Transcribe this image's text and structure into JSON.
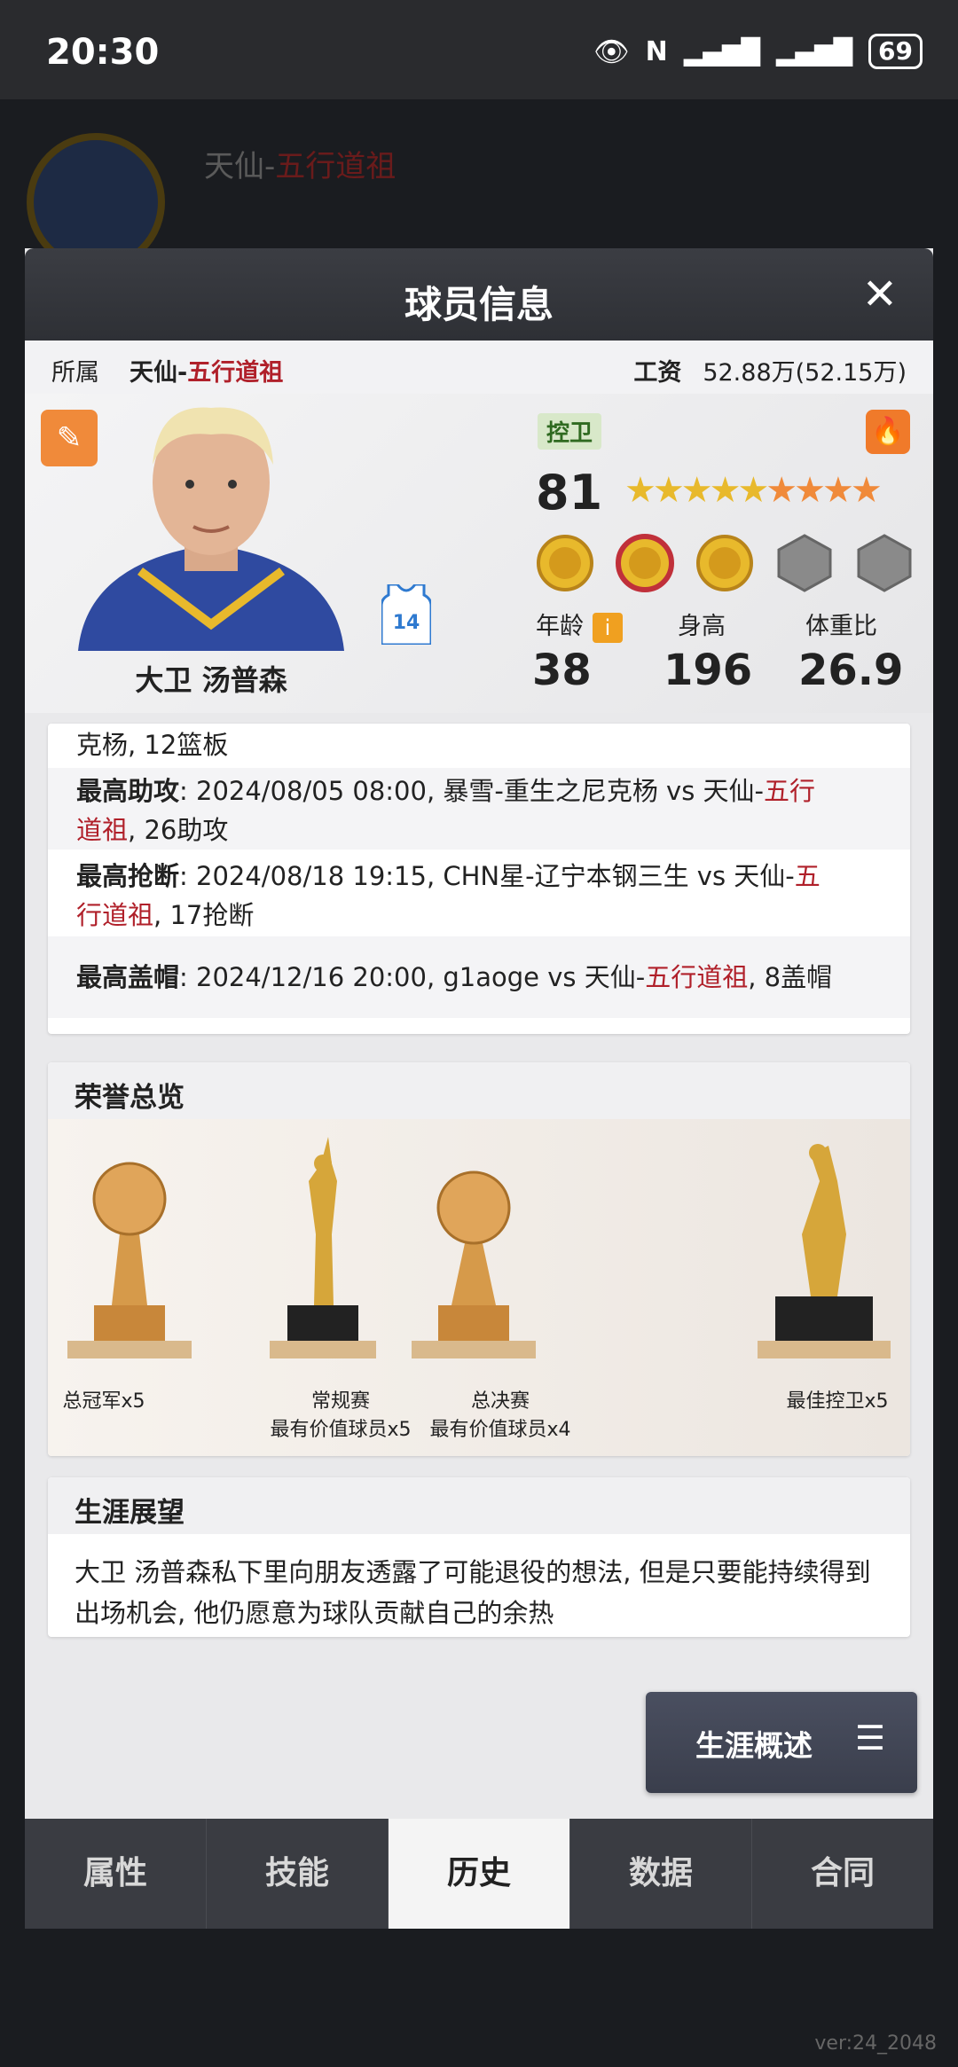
{
  "status": {
    "time": "20:30",
    "battery": "69"
  },
  "background": {
    "team_prefix": "天仙-",
    "team_suffix": "五行道祖",
    "version": "ver:24_2048"
  },
  "modal": {
    "title": "球员信息",
    "team_label": "所属",
    "team_prefix": "天仙-",
    "team_suffix": "五行道祖",
    "salary_label": "工资",
    "salary_value": "52.88万(52.15万)"
  },
  "player": {
    "position": "控卫",
    "rating": "81",
    "stars_gold": 5,
    "stars_orange": 4,
    "jersey_number": "14",
    "name": "大卫 汤普森",
    "age_label": "年龄",
    "age": "38",
    "height_label": "身高",
    "height": "196",
    "bmi_label": "体重比",
    "bmi": "26.9"
  },
  "records": {
    "line0": "克杨, 12篮板",
    "line1_label": "最高助攻",
    "line1_text": ": 2024/08/05 08:00, 暴雪-重生之尼克杨 vs 天仙-",
    "line1_red": "五行",
    "line1_red2": "道祖",
    "line1_end": ", 26助攻",
    "line2_label": "最高抢断",
    "line2_text": ": 2024/08/18 19:15, CHN星-辽宁本钢三生 vs 天仙-",
    "line2_red": "五",
    "line2_red2": "行道祖",
    "line2_end": ", 17抢断",
    "line3_label": "最高盖帽",
    "line3_text": ": 2024/12/16 20:00, g1aoge vs 天仙-",
    "line3_red": "五行道祖",
    "line3_end": ", 8盖帽"
  },
  "honors": {
    "title": "荣誉总览",
    "items": [
      {
        "line1": "总冠军x5",
        "line2": ""
      },
      {
        "line1": "常规赛",
        "line2": "最有价值球员x5"
      },
      {
        "line1": "总决赛",
        "line2": "最有价值球员x4"
      },
      {
        "line1": "最佳控卫x5",
        "line2": ""
      }
    ]
  },
  "career": {
    "title": "生涯展望",
    "text": "大卫 汤普森私下里向朋友透露了可能退役的想法, 但是只要能持续得到出场机会, 他仍愿意为球队贡献自己的余热"
  },
  "summary_button": "生涯概述",
  "tabs": [
    "属性",
    "技能",
    "历史",
    "数据",
    "合同"
  ],
  "active_tab": "历史"
}
